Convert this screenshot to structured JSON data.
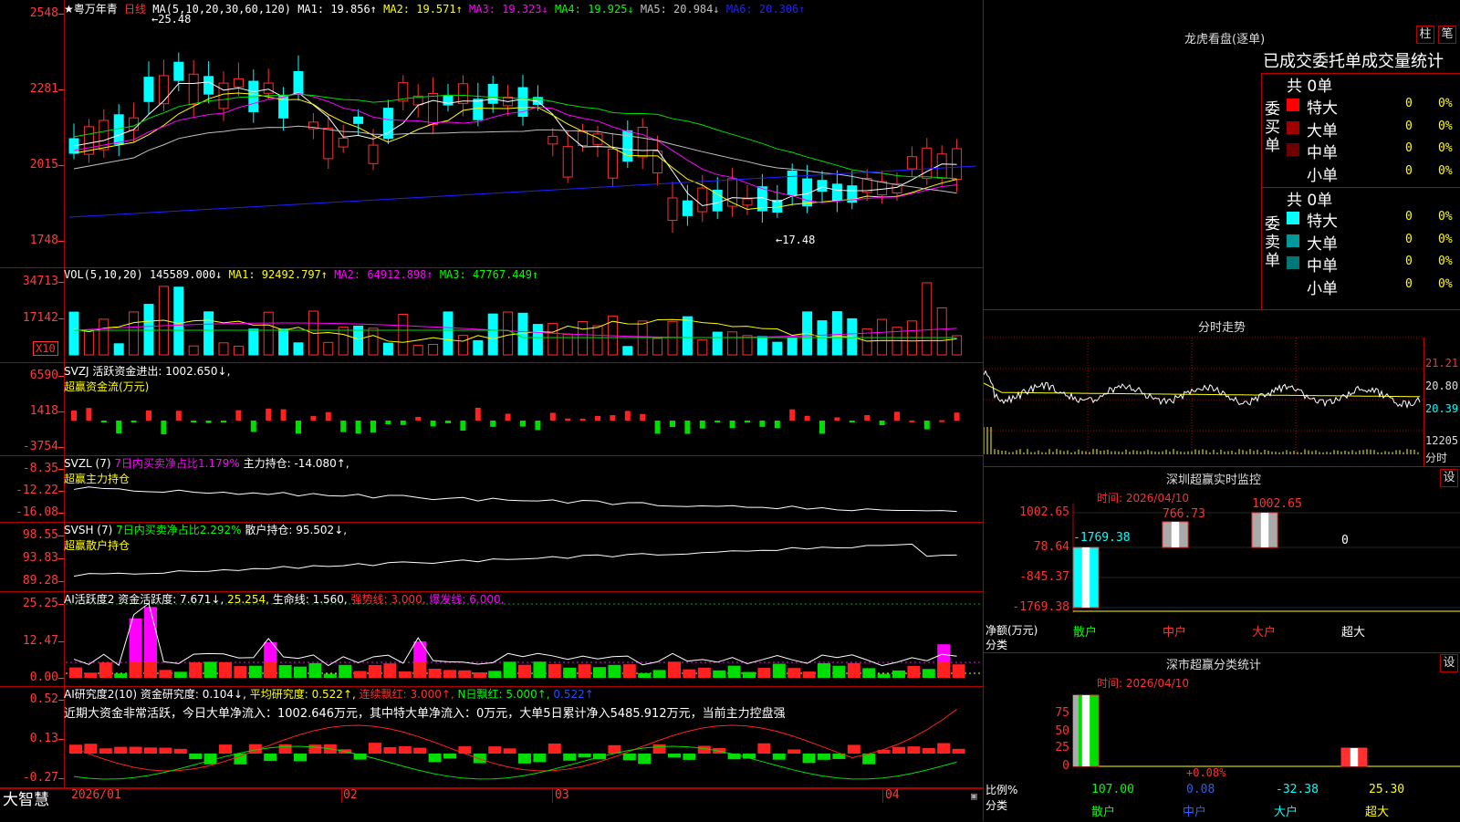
{
  "main": {
    "stock_name": "★粤万年青",
    "period": "日线",
    "ma_label": "MA(5,10,20,30,60,120)",
    "ma": [
      {
        "t": "MA1: 19.856↑",
        "c": "#ffffff"
      },
      {
        "t": "MA2: 19.571↑",
        "c": "#ffff00"
      },
      {
        "t": "MA3: 19.323↓",
        "c": "#ff00ff"
      },
      {
        "t": "MA4: 19.925↓",
        "c": "#00ff00"
      },
      {
        "t": "MA5: 20.984↓",
        "c": "#c0c0c0"
      },
      {
        "t": "MA6: 20.306↑",
        "c": "#2020ff"
      }
    ],
    "yticks": [
      "2548",
      "2281",
      "2015",
      "1748"
    ],
    "high_label": "←25.48",
    "low_label": "←17.48"
  },
  "vol": {
    "label": "VOL(5,10,20)",
    "items": [
      {
        "t": "145589.000↓",
        "c": "#ffffff"
      },
      {
        "t": "MA1: 92492.797↑",
        "c": "#ffff00"
      },
      {
        "t": "MA2: 64912.898↑",
        "c": "#ff00ff"
      },
      {
        "t": "MA3: 47767.449↑",
        "c": "#00ff00"
      }
    ],
    "yticks": [
      "34713",
      "17142"
    ],
    "unit": "X10"
  },
  "svzj": {
    "label": "SVZJ  活跃资金进出: 1002.650↓,",
    "sub": "超赢资金流(万元)",
    "yticks": [
      "6590",
      "1418",
      "-3754"
    ]
  },
  "svzl": {
    "label_a": "SVZL (7)",
    "label_b": "7日内买卖净占比1.179%",
    "label_c": "主力持仓: -14.080↑,",
    "sub": "超赢主力持仓",
    "yticks": [
      "-8.35",
      "-12.22",
      "-16.08"
    ]
  },
  "svsh": {
    "label_a": "SVSH (7)",
    "label_b": "7日内买卖净占比2.292%",
    "label_c": "散户持仓: 95.502↓,",
    "sub": "超赢散户持仓",
    "yticks": [
      "98.55",
      "93.83",
      "89.28"
    ]
  },
  "ai1": {
    "items": [
      {
        "t": "AI活跃度2 资金活跃度: 7.671↓,",
        "c": "#ffffff"
      },
      {
        "t": "25.254,",
        "c": "#ffff00"
      },
      {
        "t": "生命线: 1.560,",
        "c": "#ffffff"
      },
      {
        "t": "强势线: 3.000,",
        "c": "#ff3030"
      },
      {
        "t": "爆发线: 6.000,",
        "c": "#ff00ff"
      }
    ],
    "yticks": [
      "25.25",
      "12.47",
      "0.00"
    ]
  },
  "ai2": {
    "items": [
      {
        "t": "AI研究度2(10) 资金研究度: 0.104↓,",
        "c": "#ffffff"
      },
      {
        "t": "平均研究度: 0.522↑,",
        "c": "#ffff00"
      },
      {
        "t": "连续飘红: 3.000↑,",
        "c": "#ff3030"
      },
      {
        "t": "N日飘红: 5.000↑,",
        "c": "#00ff00"
      },
      {
        "t": "0.522↑",
        "c": "#2050ff"
      }
    ],
    "summary": "近期大资金非常活跃，今日大单净流入：1002.646万元，其中特大单净流入：0万元，大单5日累计净入5485.912万元，当前主力控盘强",
    "yticks": [
      "0.52",
      "0.13",
      "-0.27"
    ]
  },
  "xaxis": {
    "brand": "大智慧",
    "labels": [
      "2026/01",
      "02",
      "03",
      "04"
    ]
  },
  "dragon": {
    "title": "龙虎看盘(逐单)",
    "btn1": "柱",
    "btn2": "笔",
    "header": "已成交委托单成交量统计",
    "buy_label": "委买单",
    "sell_label": "委卖单",
    "buy_total": "共 0单",
    "sell_total": "共 0单",
    "buy_rows": [
      {
        "name": "特大",
        "v": "0",
        "p": "0%",
        "c": "#ff0000"
      },
      {
        "name": "大单",
        "v": "0",
        "p": "0%",
        "c": "#a00000"
      },
      {
        "name": "中单",
        "v": "0",
        "p": "0%",
        "c": "#700000"
      },
      {
        "name": "小单",
        "v": "0",
        "p": "0%",
        "c": "#000000"
      }
    ],
    "sell_rows": [
      {
        "name": "特大",
        "v": "0",
        "p": "0%",
        "c": "#00ffff"
      },
      {
        "name": "大单",
        "v": "0",
        "p": "0%",
        "c": "#009999"
      },
      {
        "name": "中单",
        "v": "0",
        "p": "0%",
        "c": "#007777"
      },
      {
        "name": "小单",
        "v": "0",
        "p": "0%",
        "c": "#000000"
      }
    ]
  },
  "intraday": {
    "title": "分时走势",
    "yticks": [
      "21.21",
      "20.80",
      "20.39",
      "12205"
    ],
    "unit": "分时"
  },
  "monitor": {
    "title": "深圳超赢实时监控",
    "btn": "设",
    "date": "时间: 2026/04/10",
    "yticks": [
      "1002.65",
      "78.64",
      "-845.37",
      "-1769.38"
    ],
    "ylabel": "净额(万元)",
    "cat_label": "分类",
    "bar_labels": [
      "-1769.38",
      "766.73",
      "1002.65",
      "0"
    ],
    "cats": [
      "散户",
      "中户",
      "大户",
      "超大"
    ]
  },
  "classify": {
    "title": "深市超赢分类统计",
    "btn": "设",
    "date": "时间: 2026/04/10",
    "yticks": [
      "75",
      "50",
      "25",
      "0"
    ],
    "ylabel": "比例%",
    "cat_label": "分类",
    "bar_labels": [
      "107.00",
      "0.08",
      "-32.38",
      "25.30"
    ],
    "top_label": "+0.08%",
    "cats": [
      "散户",
      "中户",
      "大户",
      "超大"
    ]
  }
}
